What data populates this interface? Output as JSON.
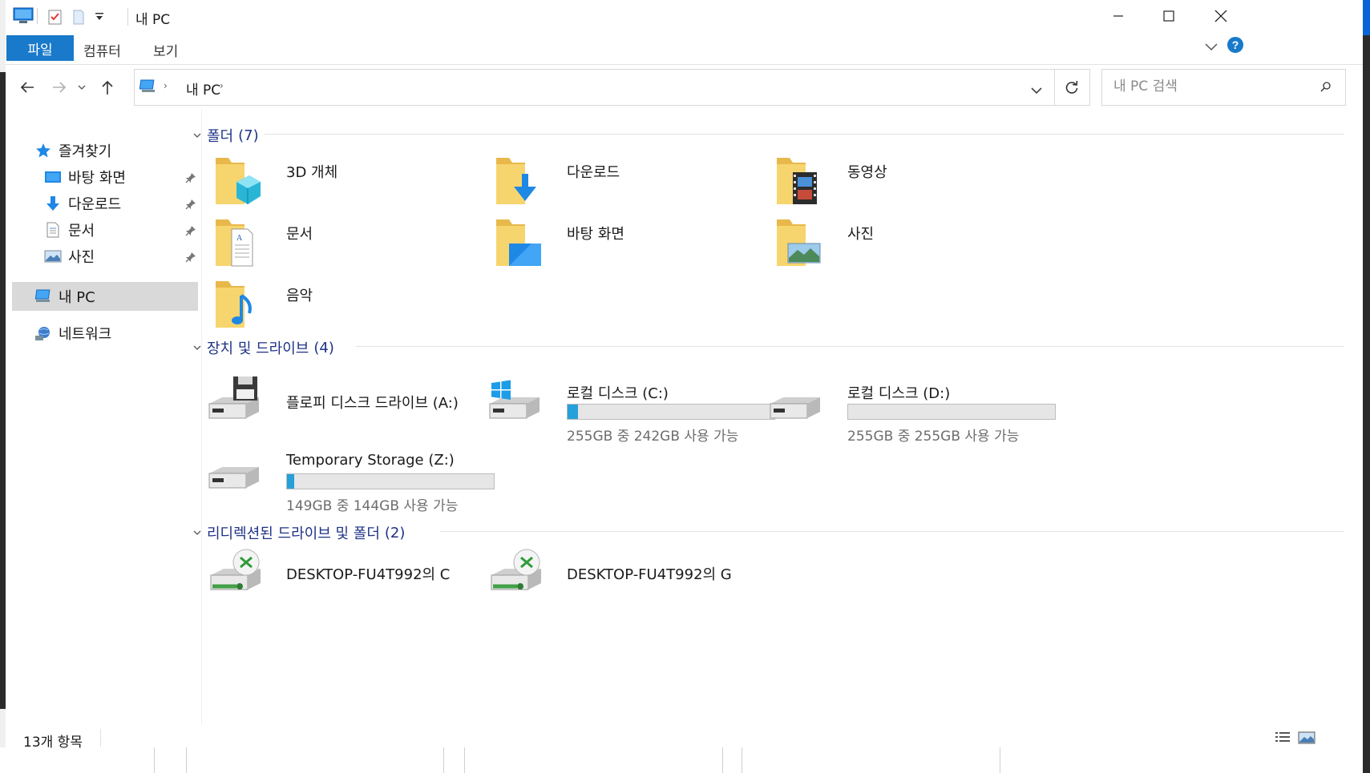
{
  "window": {
    "title": "내 PC"
  },
  "ribbon": {
    "tabs": [
      "파일",
      "컴퓨터",
      "보기"
    ]
  },
  "address": {
    "path_segment": "내 PC"
  },
  "search": {
    "placeholder": "내 PC 검색"
  },
  "sidebar": {
    "quick_access": "즐겨찾기",
    "pinned": [
      {
        "label": "바탕 화면",
        "icon": "desktop-icon"
      },
      {
        "label": "다운로드",
        "icon": "download-arrow-icon"
      },
      {
        "label": "문서",
        "icon": "document-icon"
      },
      {
        "label": "사진",
        "icon": "picture-icon"
      }
    ],
    "this_pc": "내 PC",
    "network": "네트워크"
  },
  "groups": {
    "folders": {
      "name": "폴더",
      "count": "(7)",
      "items": [
        "3D 개체",
        "다운로드",
        "동영상",
        "문서",
        "바탕 화면",
        "사진",
        "음악"
      ]
    },
    "devices": {
      "name": "장치 및 드라이브",
      "count": "(4)",
      "items": [
        {
          "label": "플로피 디스크 드라이브 (A:)"
        },
        {
          "label": "로컬 디스크 (C:)",
          "usage": "255GB 중 242GB 사용 가능",
          "used_fraction": 0.051
        },
        {
          "label": "로컬 디스크 (D:)",
          "usage": "255GB 중 255GB 사용 가능",
          "used_fraction": 0.0
        },
        {
          "label": "Temporary Storage (Z:)",
          "usage": "149GB 중 144GB 사용 가능",
          "used_fraction": 0.034
        }
      ]
    },
    "redirected": {
      "name": "리디렉션된 드라이브 및 폴더",
      "count": "(2)",
      "items": [
        "DESKTOP-FU4T992의 C",
        "DESKTOP-FU4T992의 G"
      ]
    }
  },
  "status": {
    "item_count": "13개 항목"
  },
  "colors": {
    "accent": "#1979ca",
    "group_header": "#1e3287",
    "bar_fill": "#26a0da",
    "folder": "#f4c54e"
  }
}
